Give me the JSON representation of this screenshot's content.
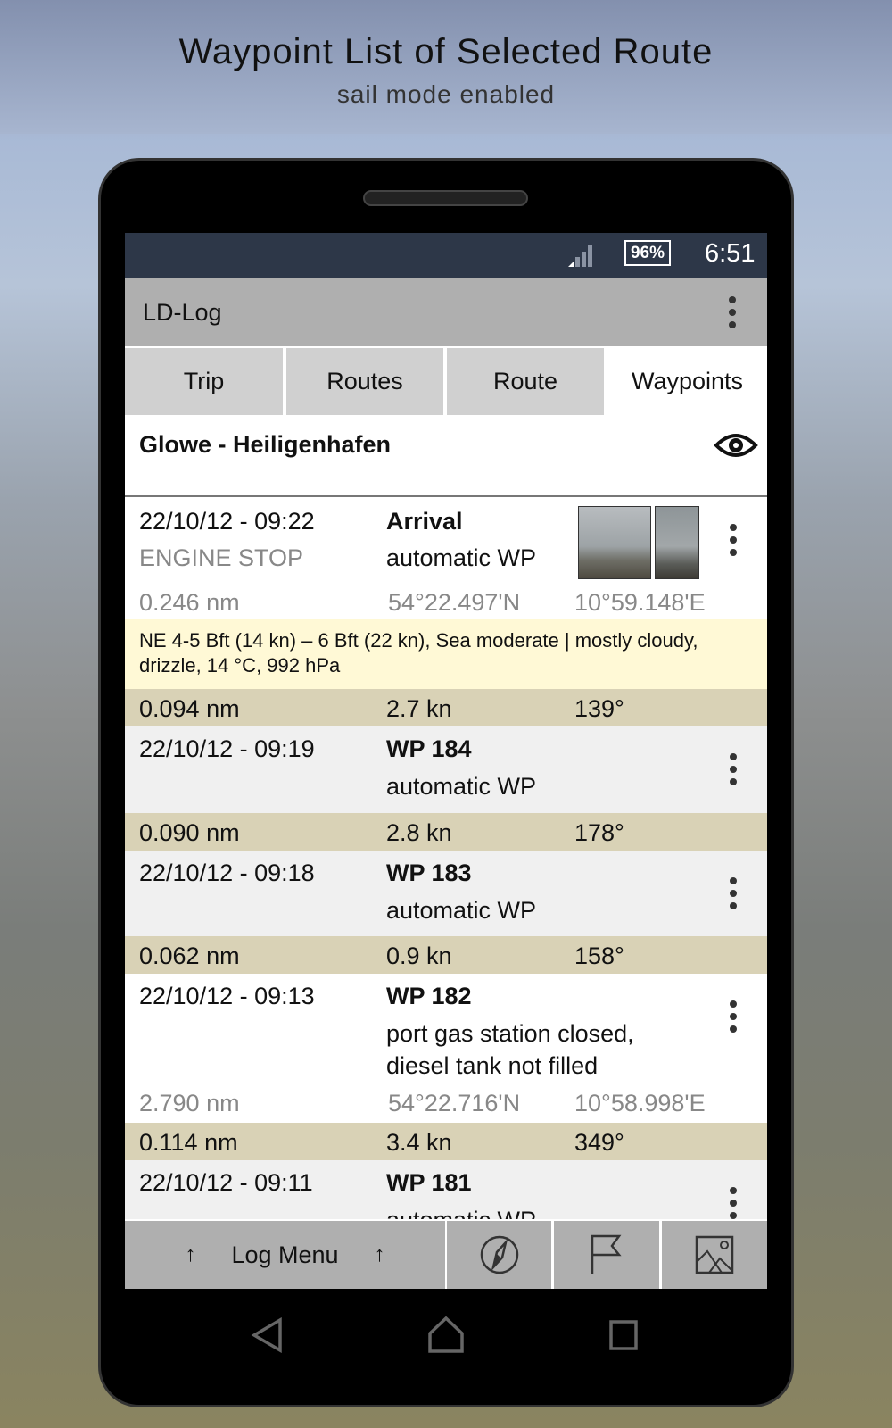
{
  "banner": {
    "title": "Waypoint List of Selected Route",
    "subtitle": "sail mode enabled"
  },
  "status_bar": {
    "battery": "96%",
    "time": "6:51",
    "icons": [
      "signal-icon",
      "battery-icon"
    ]
  },
  "app_bar": {
    "title": "LD-Log",
    "menu_icon": "more-vert-icon"
  },
  "tabs": [
    {
      "label": "Trip",
      "active": false
    },
    {
      "label": "Routes",
      "active": false
    },
    {
      "label": "Route",
      "active": false
    },
    {
      "label": "Waypoints",
      "active": true
    }
  ],
  "route": {
    "name": "Glowe - Heiligenhafen",
    "icon": "eye-icon"
  },
  "waypoints": [
    {
      "datetime": "22/10/12 - 09:22",
      "name": "Arrival",
      "subtitle": "ENGINE STOP",
      "type": "automatic WP",
      "distance": "0.246 nm",
      "lat": "54°22.497'N",
      "lon": "10°59.148'E",
      "weather": "NE 4-5 Bft (14 kn) – 6 Bft (22 kn), Sea moderate | mostly cloudy, drizzle, 14 °C, 992 hPa"
    },
    {
      "datetime": "22/10/12 - 09:19",
      "name": "WP 184",
      "type": "automatic WP"
    },
    {
      "datetime": "22/10/12 - 09:18",
      "name": "WP 183",
      "type": "automatic WP"
    },
    {
      "datetime": "22/10/12 - 09:13",
      "name": "WP 182",
      "note1": "port gas station closed,",
      "note2": "diesel tank not filled",
      "distance": "2.790 nm",
      "lat": "54°22.716'N",
      "lon": "10°58.998'E"
    },
    {
      "datetime": "22/10/12 - 09:11",
      "name": "WP 181",
      "type": "automatic WP"
    }
  ],
  "legs": [
    {
      "distance": "0.094 nm",
      "speed": "2.7 kn",
      "course": "139°"
    },
    {
      "distance": "0.090 nm",
      "speed": "2.8 kn",
      "course": "178°"
    },
    {
      "distance": "0.062 nm",
      "speed": "0.9 kn",
      "course": "158°"
    },
    {
      "distance": "0.114 nm",
      "speed": "3.4 kn",
      "course": "349°"
    }
  ],
  "bottom_bar": {
    "log_menu": "Log Menu",
    "arrow": "↑",
    "icons": [
      "compass-icon",
      "flag-icon",
      "image-icon"
    ]
  },
  "colors": {
    "status_bar": "#2d3748",
    "app_bar": "#afafaf",
    "leg_row": "#d9d2b6",
    "weather_row": "#fff9d6"
  }
}
